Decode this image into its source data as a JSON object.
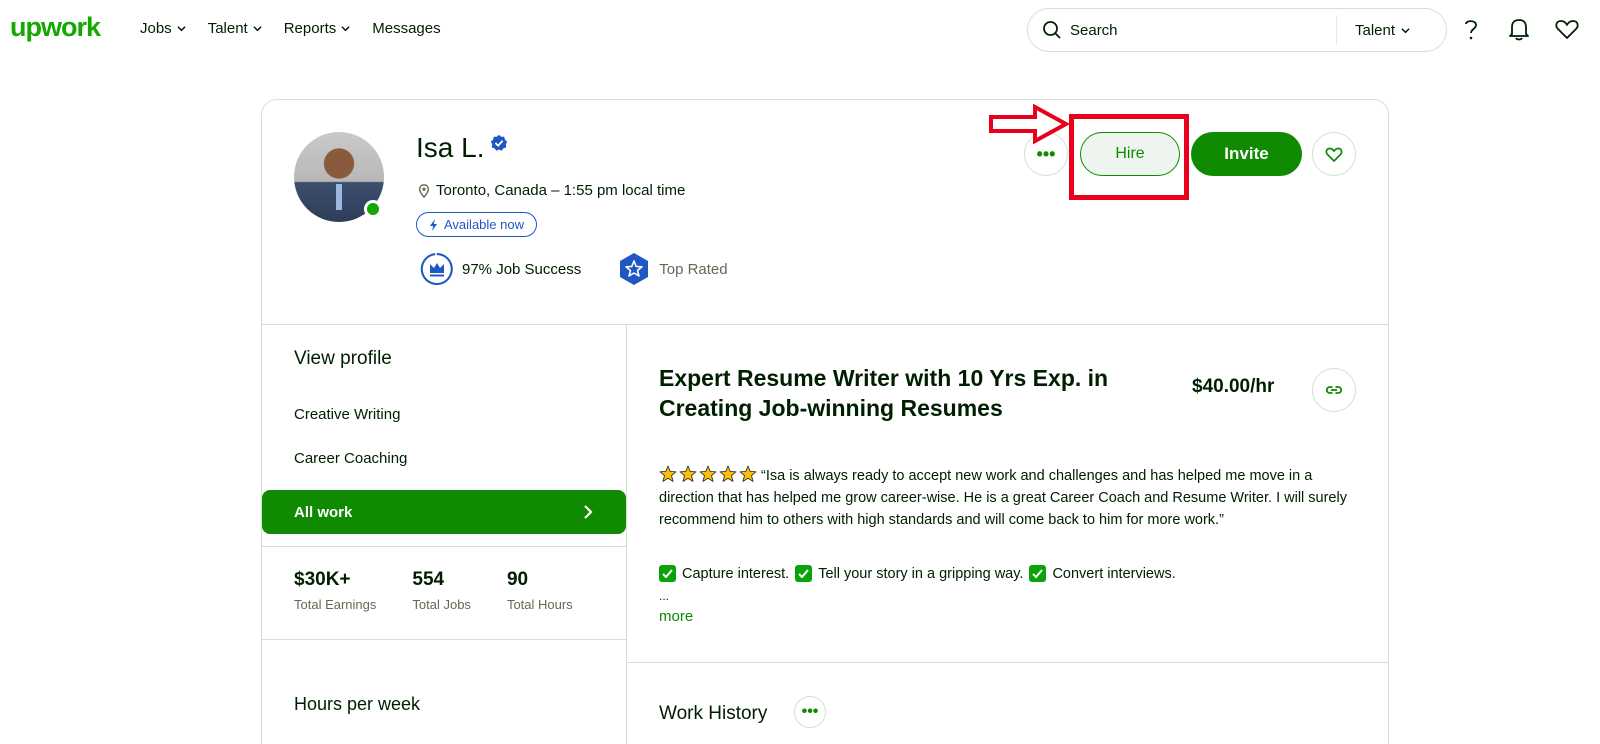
{
  "nav": {
    "logo": "upwork",
    "links": [
      {
        "label": "Jobs"
      },
      {
        "label": "Talent"
      },
      {
        "label": "Reports"
      },
      {
        "label": "Messages"
      }
    ],
    "search": {
      "placeholder": "Search",
      "scope": "Talent"
    },
    "icons": [
      "help-icon",
      "bell-icon",
      "heart-icon"
    ],
    "brand_color": "#14a800"
  },
  "profile": {
    "name": "Isa L.",
    "location": "Toronto, Canada – 1:55 pm local time",
    "availability": "Available now",
    "job_success": "97% Job Success",
    "top_rated": "Top Rated",
    "actions": {
      "more": "•••",
      "hire": "Hire",
      "invite": "Invite"
    }
  },
  "sidebar": {
    "view_profile": "View profile",
    "items": [
      {
        "label": "Creative Writing"
      },
      {
        "label": "Career Coaching"
      },
      {
        "label": "All work"
      }
    ],
    "stats": [
      {
        "value": "$30K+",
        "label": "Total Earnings"
      },
      {
        "value": "554",
        "label": "Total Jobs"
      },
      {
        "value": "90",
        "label": "Total Hours"
      }
    ],
    "hours_per_week": "Hours per week"
  },
  "main": {
    "title": "Expert Resume Writer with 10 Yrs Exp. in Creating Job-winning Resumes",
    "rate": "$40.00/hr",
    "rating": 5,
    "testimonial": "“Isa is always ready to accept new work and challenges and has helped me move in a direction that has helped me grow career-wise. He is a great Career Coach and Resume Writer. I will surely recommend him to others with high standards and will come back to him for more work.”",
    "checks": [
      "Capture interest.",
      "Tell your story in a gripping way.",
      "Convert interviews."
    ],
    "ellipsis": "...",
    "more_link": "more",
    "work_history": "Work History",
    "work_history_more": "•••"
  }
}
